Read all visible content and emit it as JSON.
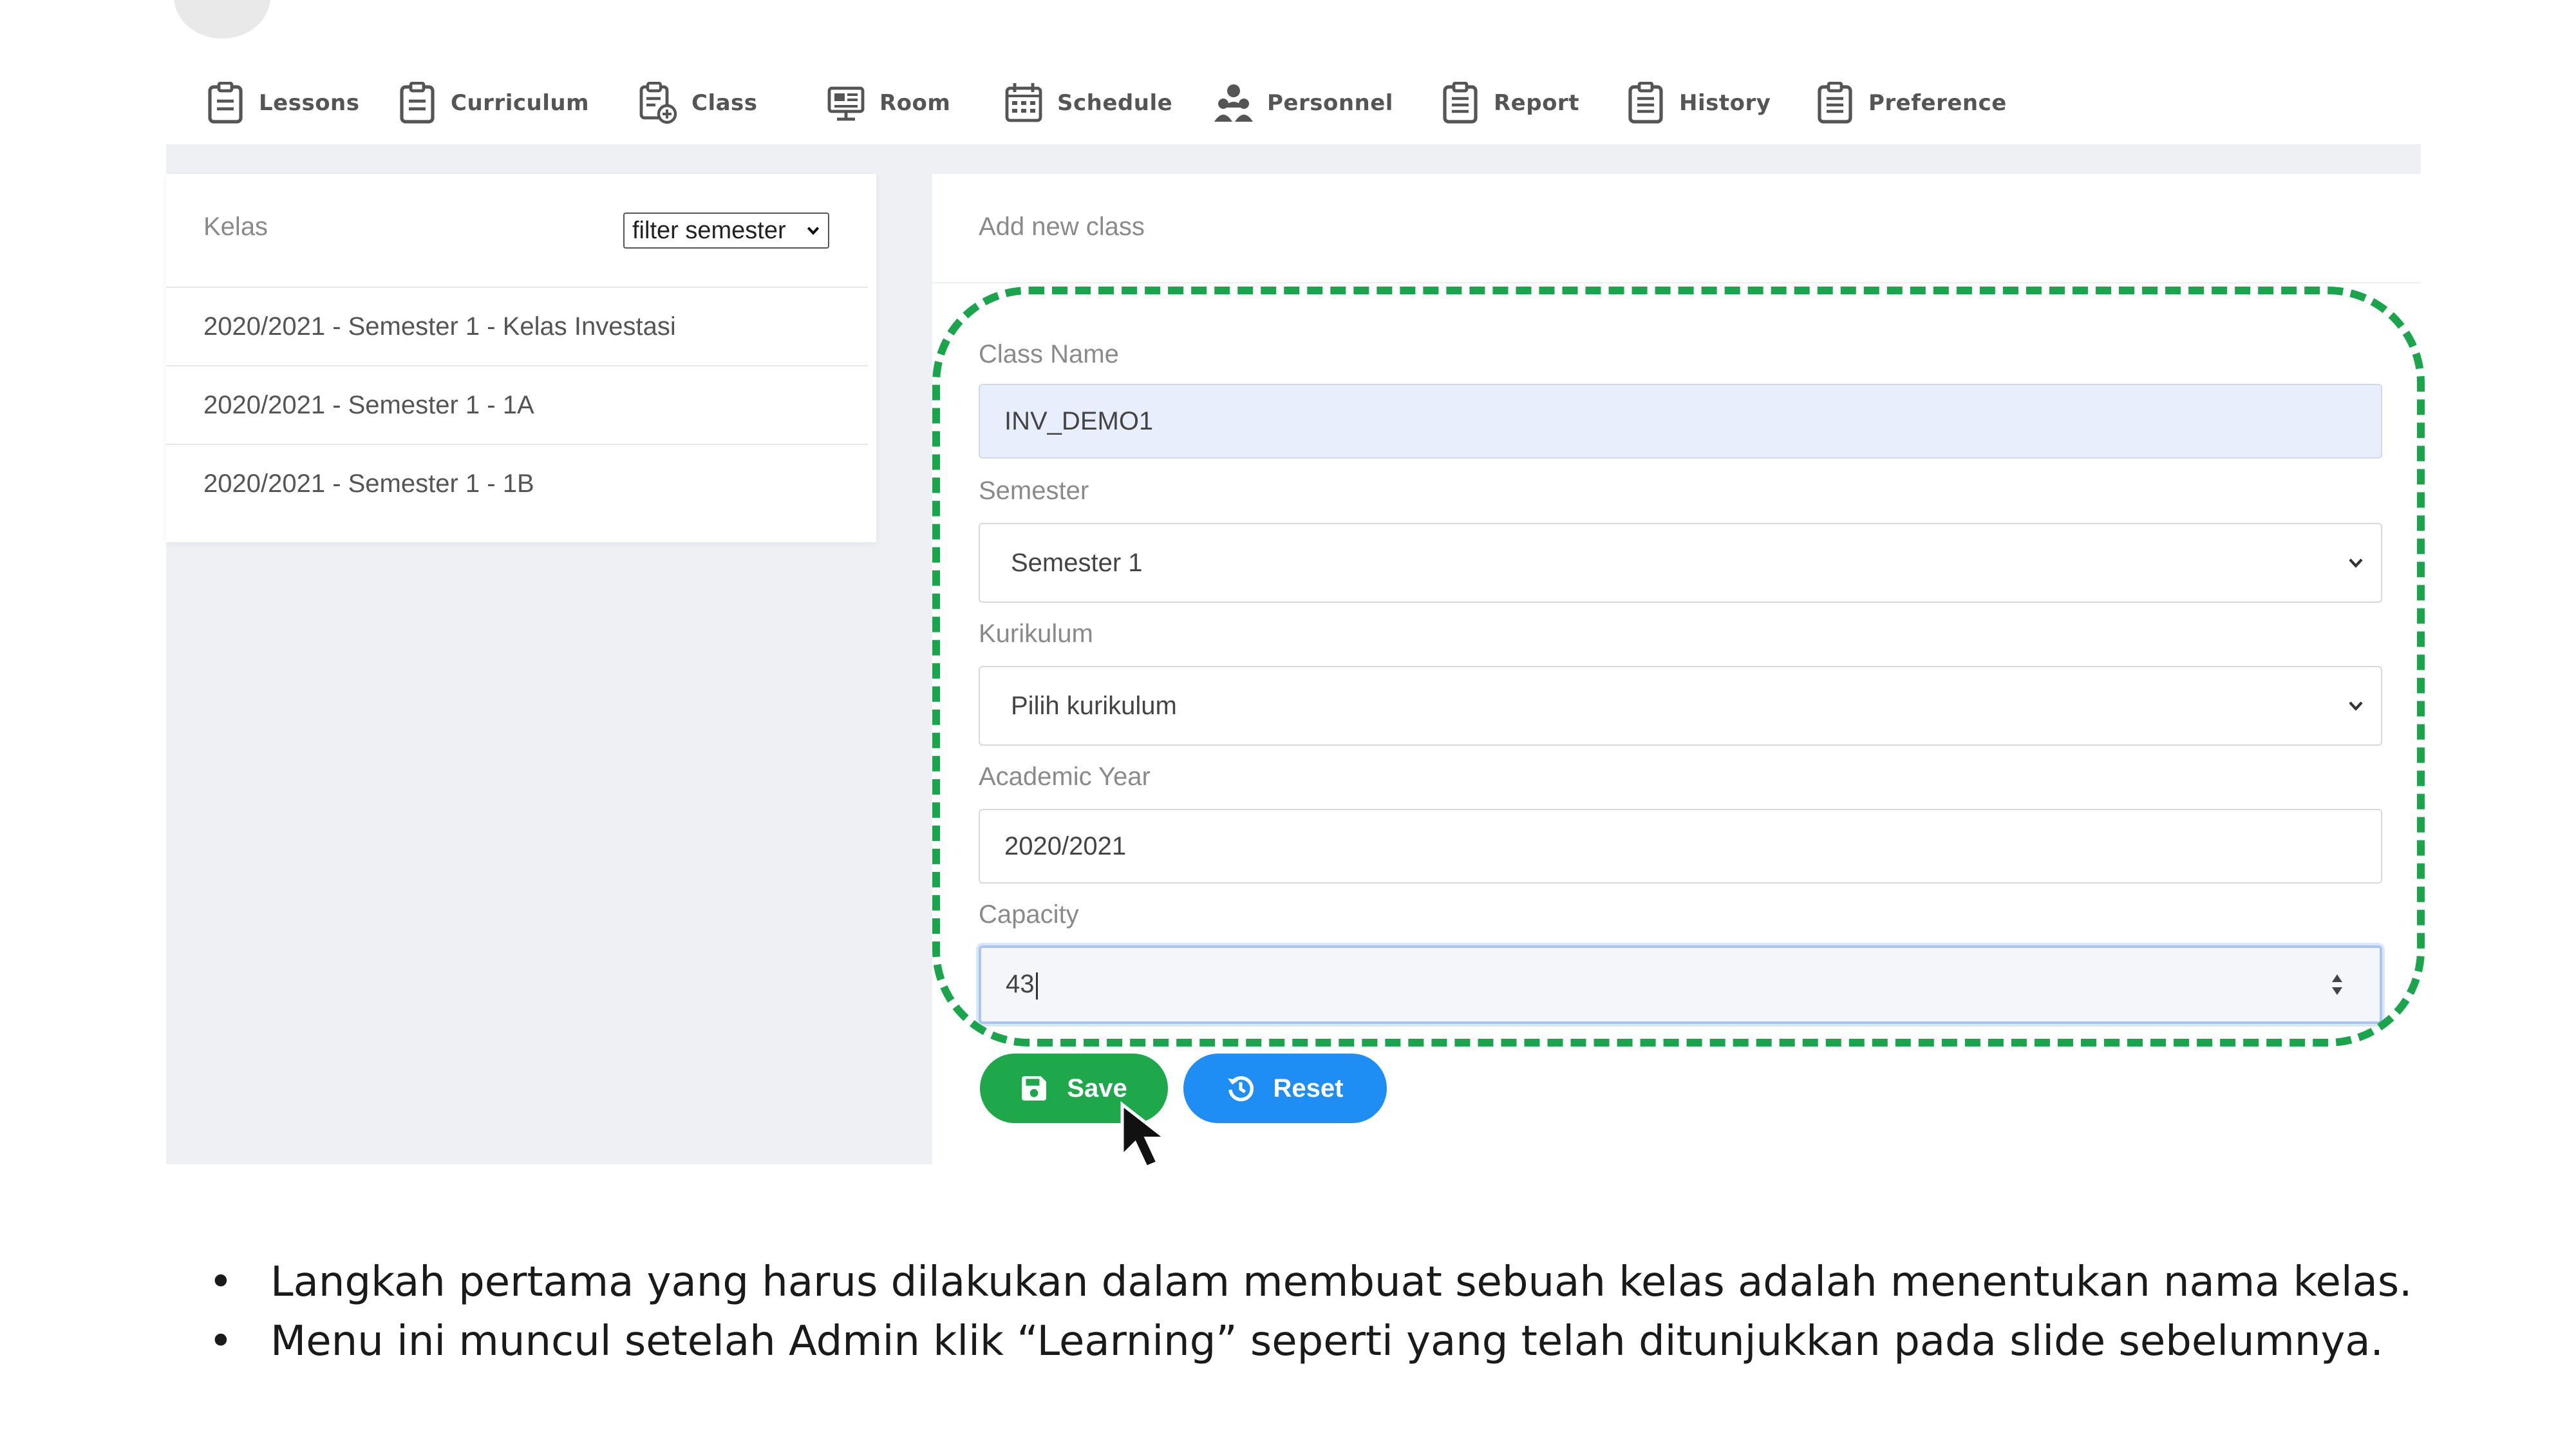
{
  "nav": {
    "items": [
      {
        "label": "Lessons",
        "icon": "clipboard-icon"
      },
      {
        "label": "Curriculum",
        "icon": "clipboard-icon"
      },
      {
        "label": "Class",
        "icon": "clipboard-add-icon"
      },
      {
        "label": "Room",
        "icon": "monitor-icon"
      },
      {
        "label": "Schedule",
        "icon": "calendar-icon"
      },
      {
        "label": "Personnel",
        "icon": "people-icon"
      },
      {
        "label": "Report",
        "icon": "clipboard-list-icon"
      },
      {
        "label": "History",
        "icon": "clipboard-list-icon"
      },
      {
        "label": "Preference",
        "icon": "clipboard-list-icon"
      }
    ]
  },
  "left_panel": {
    "title": "Kelas",
    "filter_placeholder": "filter semester",
    "classes": [
      "2020/2021 - Semester 1 - Kelas Investasi",
      "2020/2021 - Semester 1 - 1A",
      "2020/2021 - Semester 1 - 1B"
    ]
  },
  "form": {
    "title": "Add new class",
    "class_name_label": "Class Name",
    "class_name_value": "INV_DEMO1",
    "semester_label": "Semester",
    "semester_value": "Semester 1",
    "curriculum_label": "Kurikulum",
    "curriculum_value": "Pilih kurikulum",
    "year_label": "Academic Year",
    "year_value": "2020/2021",
    "capacity_label": "Capacity",
    "capacity_value": "43",
    "save_label": "Save",
    "reset_label": "Reset"
  },
  "notes": [
    "Langkah pertama yang harus dilakukan dalam membuat sebuah kelas adalah menentukan nama kelas.",
    "Menu ini muncul setelah Admin klik “Learning” seperti yang telah ditunjukkan pada slide sebelumnya."
  ],
  "colors": {
    "save_button": "#1ea84b",
    "reset_button": "#1e8ef4",
    "highlight_dash": "#1aa54d",
    "filled_input": "#e8eefc"
  }
}
